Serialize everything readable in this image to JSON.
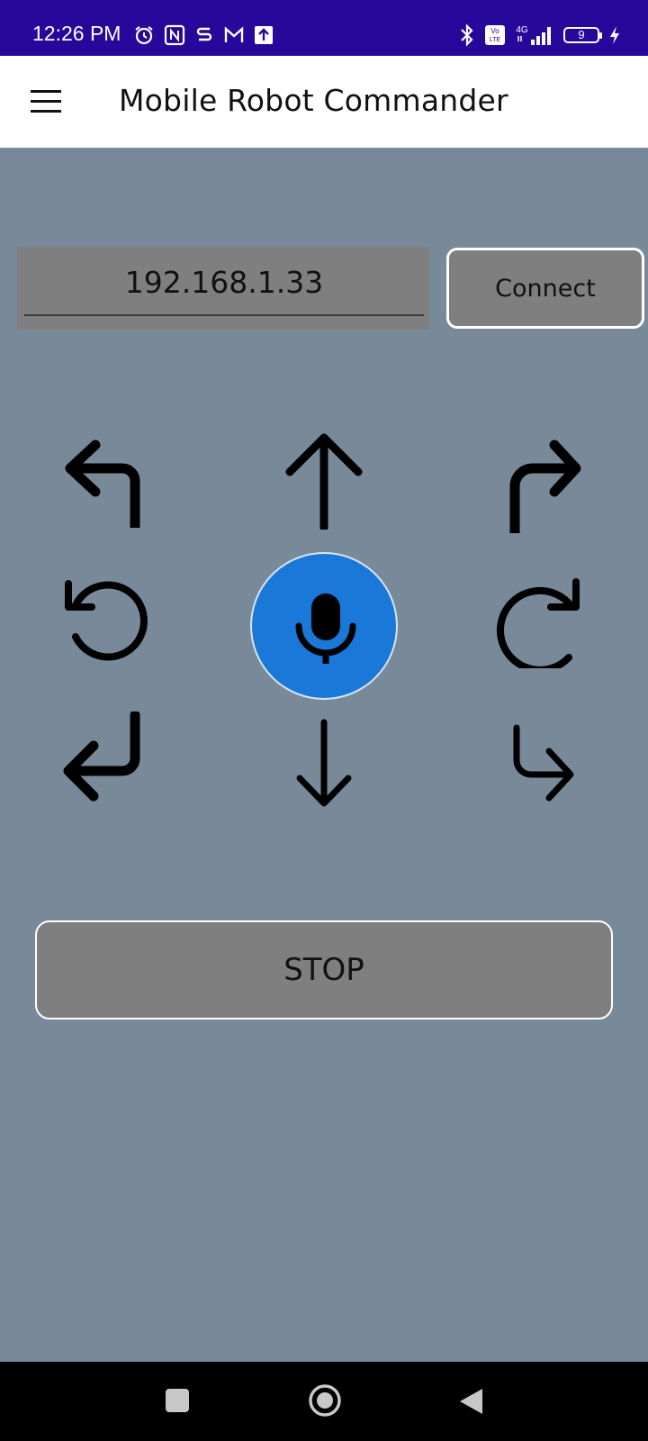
{
  "status_bar": {
    "time": "12:26 PM",
    "left_icons": [
      "alarm-icon",
      "nfc-icon",
      "app-s-icon",
      "gmail-icon",
      "upload-icon"
    ],
    "right_icons": [
      "bluetooth-icon",
      "volte-icon",
      "signal-4g-icon"
    ],
    "network_label": "4G",
    "volte_label": "Vo LTE",
    "battery_level": "9"
  },
  "app_bar": {
    "title": "Mobile Robot Commander",
    "menu_icon": "hamburger-menu-icon"
  },
  "connection": {
    "ip_value": "192.168.1.33",
    "connect_label": "Connect"
  },
  "controls": {
    "turn_left_forward": "arrow-turn-up-left-icon",
    "forward": "arrow-up-icon",
    "turn_right_forward": "arrow-turn-up-right-icon",
    "rotate_left": "rotate-counterclockwise-icon",
    "voice": "microphone-icon",
    "rotate_right": "rotate-clockwise-icon",
    "turn_left_backward": "arrow-turn-down-left-icon",
    "backward": "arrow-down-icon",
    "turn_right_backward": "arrow-turn-down-right-icon",
    "stop_label": "STOP"
  },
  "colors": {
    "status_bar": "#26089a",
    "background": "#788a99",
    "input_bg": "#7f7f7f",
    "mic_button": "#1a78d8"
  },
  "nav_bar": {
    "buttons": [
      "recents-square-icon",
      "home-circle-icon",
      "back-triangle-icon"
    ]
  }
}
